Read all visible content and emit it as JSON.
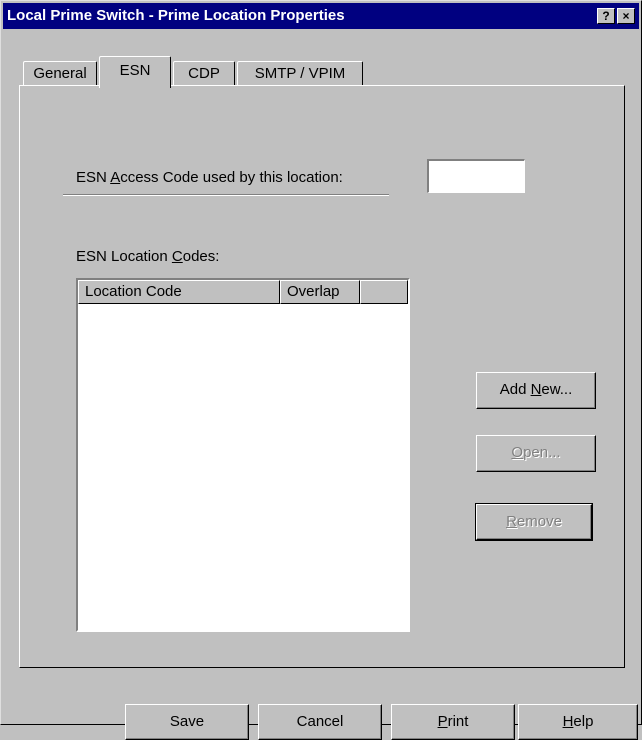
{
  "window": {
    "title": "Local Prime Switch - Prime Location Properties",
    "help_button": "?",
    "close_button": "×"
  },
  "tabs": [
    {
      "label": "General",
      "selected": false
    },
    {
      "label": "ESN",
      "selected": true
    },
    {
      "label": "CDP",
      "selected": false
    },
    {
      "label": "SMTP / VPIM",
      "selected": false
    }
  ],
  "esn": {
    "access_code_label_pre": "ESN ",
    "access_code_label_accel": "A",
    "access_code_label_post": "ccess Code used by this location:",
    "access_code_value": "",
    "location_codes_label_pre": "ESN Location ",
    "location_codes_label_accel": "C",
    "location_codes_label_post": "odes:",
    "columns": [
      "Location Code",
      "Overlap",
      ""
    ],
    "rows": []
  },
  "side_buttons": {
    "add_pre": "Add ",
    "add_accel": "N",
    "add_post": "ew...",
    "open_accel": "O",
    "open_post": "pen...",
    "remove_accel": "R",
    "remove_post": "emove"
  },
  "footer": {
    "save": "Save",
    "cancel": "Cancel",
    "print_accel": "P",
    "print_post": "rint",
    "help_accel": "H",
    "help_post": "elp"
  },
  "colors": {
    "face": "#c0c0c0",
    "titlebar": "#000080",
    "disabled_text": "#808080"
  }
}
